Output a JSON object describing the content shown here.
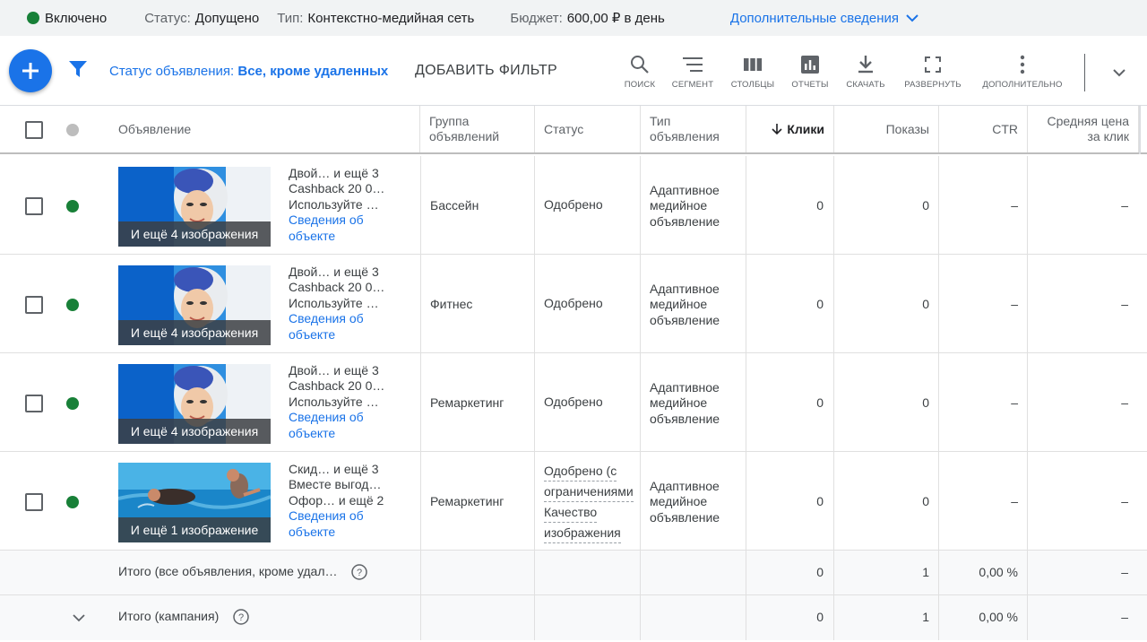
{
  "status_bar": {
    "state": "Включено",
    "status_label": "Статус:",
    "status_value": "Допущено",
    "type_label": "Тип:",
    "type_value": "Контекстно-медийная сеть",
    "budget_label": "Бюджет:",
    "budget_value": "600,00 ₽ в день",
    "more_label": "Дополнительные сведения"
  },
  "toolbar": {
    "filter_prefix": "Статус объявления:",
    "filter_value": "Все, кроме удаленных",
    "add_filter": "ДОБАВИТЬ ФИЛЬТР",
    "tools": [
      {
        "label": "ПОИСК",
        "icon": "search-icon"
      },
      {
        "label": "СЕГМЕНТ",
        "icon": "segment-icon"
      },
      {
        "label": "СТОЛБЦЫ",
        "icon": "columns-icon"
      },
      {
        "label": "ОТЧЕТЫ",
        "icon": "reports-icon"
      },
      {
        "label": "СКАЧАТЬ",
        "icon": "download-icon"
      },
      {
        "label": "РАЗВЕРНУТЬ",
        "icon": "expand-icon"
      },
      {
        "label": "ДОПОЛНИТЕЛЬНО",
        "icon": "more-vert-icon"
      }
    ]
  },
  "table": {
    "columns": {
      "ad": "Объявление",
      "ad_group_1": "Группа",
      "ad_group_2": "объявлений",
      "status": "Статус",
      "ad_type_1": "Тип",
      "ad_type_2": "объявления",
      "clicks": "Клики",
      "impressions": "Показы",
      "ctr": "CTR",
      "cpc_1": "Средняя цена",
      "cpc_2": "за клик"
    },
    "rows": [
      {
        "thumb_overlay": "И ещё 4 изображения",
        "line1": "Двой…  и ещё 3",
        "line2": "Cashback 20 0…",
        "line3": "Используйте …",
        "details_1": "Сведения об",
        "details_2": "объекте",
        "ad_group": "Бассейн",
        "status": "Одобрено",
        "type_1": "Адаптивное",
        "type_2": "медийное",
        "type_3": "объявление",
        "clicks": "0",
        "impressions": "0",
        "ctr": "–",
        "cpc": "–"
      },
      {
        "thumb_overlay": "И ещё 4 изображения",
        "line1": "Двой…  и ещё 3",
        "line2": "Cashback 20 0…",
        "line3": "Используйте …",
        "details_1": "Сведения об",
        "details_2": "объекте",
        "ad_group": "Фитнес",
        "status": "Одобрено",
        "type_1": "Адаптивное",
        "type_2": "медийное",
        "type_3": "объявление",
        "clicks": "0",
        "impressions": "0",
        "ctr": "–",
        "cpc": "–"
      },
      {
        "thumb_overlay": "И ещё 4 изображения",
        "line1": "Двой…  и ещё 3",
        "line2": "Cashback 20 0…",
        "line3": "Используйте …",
        "details_1": "Сведения об",
        "details_2": "объекте",
        "ad_group": "Ремаркетинг",
        "status": "Одобрено",
        "type_1": "Адаптивное",
        "type_2": "медийное",
        "type_3": "объявление",
        "clicks": "0",
        "impressions": "0",
        "ctr": "–",
        "cpc": "–"
      },
      {
        "thumb_overlay": "И ещё 1 изображение",
        "line1": "Скид…  и ещё 3",
        "line2": "Вместе выгод…",
        "line3": "Офор…  и ещё 2",
        "details_1": "Сведения об",
        "details_2": "объекте",
        "ad_group": "Ремаркетинг",
        "status_1": "Одобрено (с",
        "status_2": "ограничениями",
        "status_3": "Качество",
        "status_4": "изображения",
        "type_1": "Адаптивное",
        "type_2": "медийное",
        "type_3": "объявление",
        "clicks": "0",
        "impressions": "0",
        "ctr": "–",
        "cpc": "–"
      }
    ],
    "totals": [
      {
        "label": "Итого (все объявления, кроме удал…",
        "clicks": "0",
        "impressions": "1",
        "ctr": "0,00 %",
        "cpc": "–"
      },
      {
        "label": "Итого (кампания)",
        "clicks": "0",
        "impressions": "1",
        "ctr": "0,00 %",
        "cpc": "–"
      }
    ]
  },
  "colors": {
    "accent": "#1a73e8",
    "enabled_green": "#188038",
    "total_bg": "#f8f9fa"
  }
}
